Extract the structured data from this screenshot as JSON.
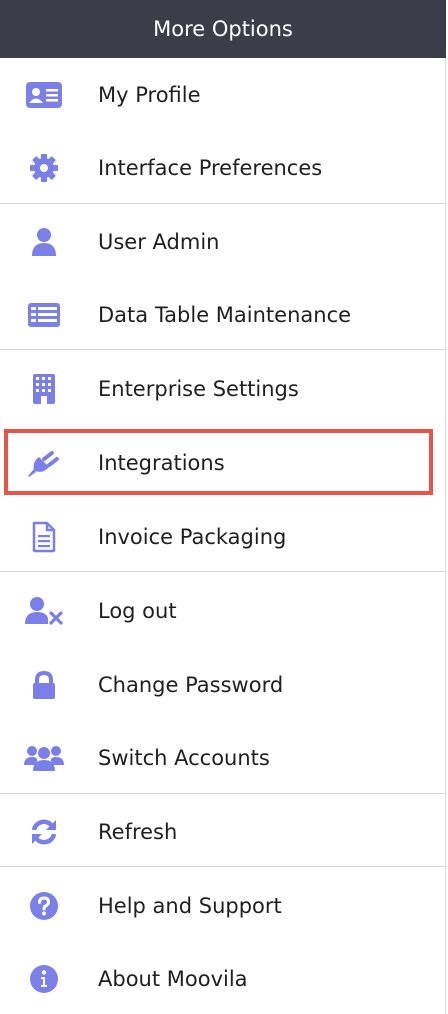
{
  "header": {
    "title": "More Options"
  },
  "colors": {
    "accent": "#7b7fe8",
    "header_bg": "#3d3d4a",
    "highlight": "#e8544a"
  },
  "items": [
    {
      "label": "My Profile",
      "icon": "id-card-icon"
    },
    {
      "label": "Interface Preferences",
      "icon": "gear-icon"
    },
    {
      "label": "User Admin",
      "icon": "user-icon"
    },
    {
      "label": "Data Table Maintenance",
      "icon": "table-icon"
    },
    {
      "label": "Enterprise Settings",
      "icon": "building-icon"
    },
    {
      "label": "Integrations",
      "icon": "plug-icon"
    },
    {
      "label": "Invoice Packaging",
      "icon": "document-icon"
    },
    {
      "label": "Log out",
      "icon": "user-remove-icon"
    },
    {
      "label": "Change Password",
      "icon": "lock-icon"
    },
    {
      "label": "Switch Accounts",
      "icon": "users-icon"
    },
    {
      "label": "Refresh",
      "icon": "refresh-icon"
    },
    {
      "label": "Help and Support",
      "icon": "question-circle-icon"
    },
    {
      "label": "About Moovila",
      "icon": "info-circle-icon"
    }
  ]
}
